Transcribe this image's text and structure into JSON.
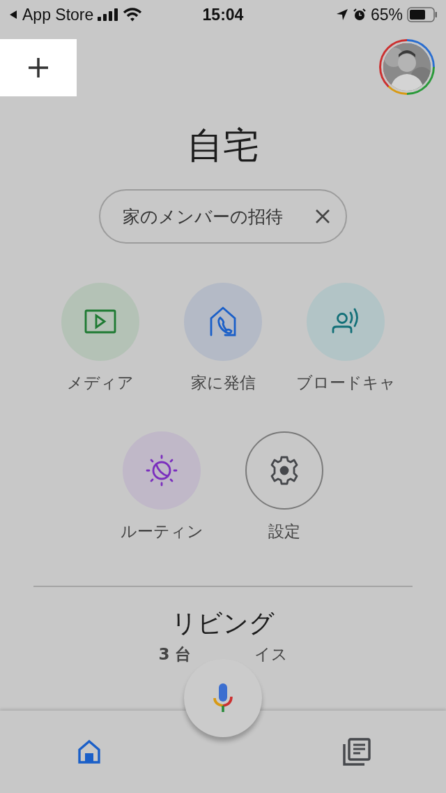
{
  "status_bar": {
    "back_label": "App Store",
    "time": "15:04",
    "battery": "65%"
  },
  "header": {
    "add_highlighted": true
  },
  "title": "自宅",
  "invite_chip": {
    "label": "家のメンバーの招待"
  },
  "actions": [
    {
      "kind": "media",
      "label": "メディア"
    },
    {
      "kind": "call",
      "label": "家に発信"
    },
    {
      "kind": "broadcast",
      "label": "ブロードキャ"
    },
    {
      "kind": "routine",
      "label": "ルーティン"
    },
    {
      "kind": "settings",
      "label": "設定"
    }
  ],
  "room": {
    "name": "リビング",
    "count_left": "3 台",
    "count_right": "イス"
  },
  "bottom_nav": [
    {
      "kind": "home",
      "selected": true
    },
    {
      "kind": "feed",
      "selected": false
    }
  ]
}
